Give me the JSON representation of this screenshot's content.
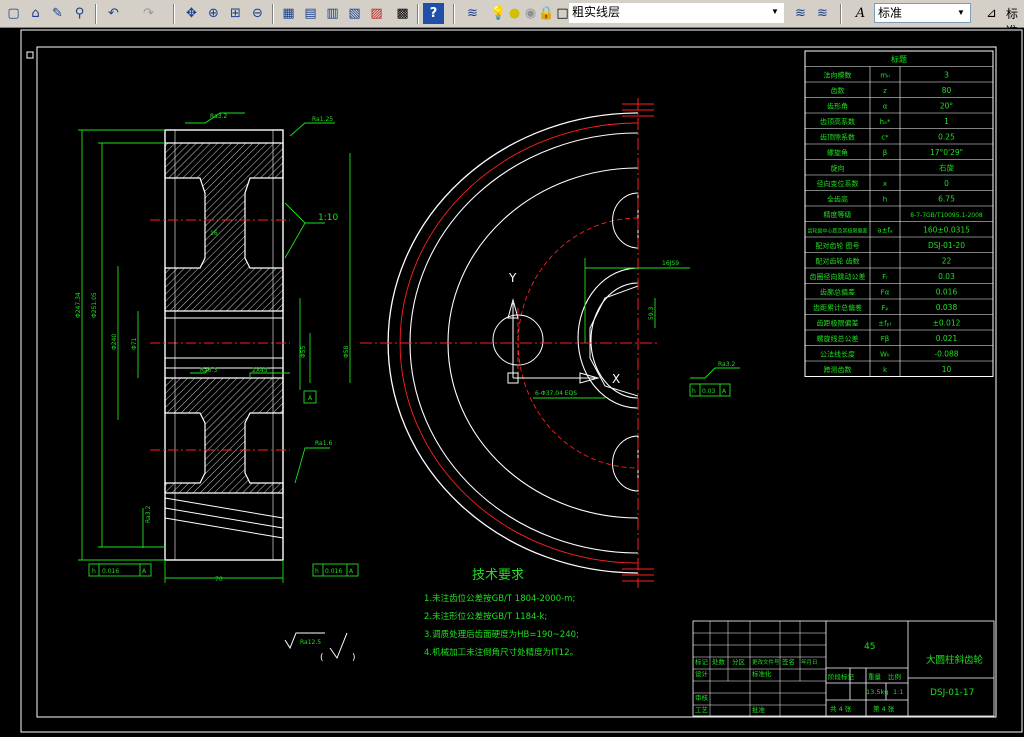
{
  "toolbar": {
    "layer_name": "粗实线层",
    "text_style": "标准",
    "text_style_2": "标准",
    "icons": [
      "new-icon",
      "open-icon",
      "pencil-icon",
      "match-prop-icon",
      "undo-icon",
      "redo-icon",
      "pan-icon",
      "zoom-realtime-icon",
      "zoom-window-icon",
      "zoom-previous-icon",
      "properties-icon",
      "design-center-icon",
      "tool-palette-icon",
      "sheet-set-icon",
      "markup-icon",
      "calculator-icon",
      "help-icon",
      "layer-manager-icon",
      "layer-state-icon",
      "text-style-icon",
      "dim-style-icon"
    ]
  },
  "drawing": {
    "colors": {
      "green": "#1ee01e",
      "white": "#ffffff",
      "red": "#ff2020",
      "yellow": "#e0e000",
      "cyan": "#30e0e0"
    },
    "tech_req": {
      "title": "技术要求",
      "lines": [
        "1.未注齿位公差按GB/T 1804-2000-m;",
        "2.未注形位公差按GB/T 1184-k;",
        "3.调质处理后齿面硬度为HB=190~240;",
        "4.机械加工未注倒角尺寸处精度为IT12。"
      ]
    },
    "param_table": {
      "header": "标题",
      "rows": [
        [
          "法向模数",
          "mₙ",
          "3"
        ],
        [
          "齿数",
          "z",
          "80"
        ],
        [
          "齿形角",
          "α",
          "20°"
        ],
        [
          "齿顶高系数",
          "hₐ*",
          "1"
        ],
        [
          "齿顶隙系数",
          "c*",
          "0.25"
        ],
        [
          "螺旋角",
          "β",
          "17°0'29\""
        ],
        [
          "旋向",
          "",
          "右旋"
        ],
        [
          "径向变位系数",
          "x",
          "0"
        ],
        [
          "全齿高",
          "h",
          "6.75"
        ],
        [
          "精度等级",
          "",
          "8-7-7GB/T10095.1-2008"
        ],
        [
          "齿轮副中心距及其极限偏差",
          "a±fₐ",
          "160±0.0315"
        ],
        [
          "配对齿轮 图号",
          "",
          "DSJ-01-20"
        ],
        [
          "配对齿轮 齿数",
          "",
          "22"
        ],
        [
          "齿圈径向跳动公差",
          "Fᵣ",
          "0.03"
        ],
        [
          "齿廓总偏差",
          "Fα",
          "0.016"
        ],
        [
          "齿距累计总偏差",
          "Fₚ",
          "0.038"
        ],
        [
          "齿距极限偏差",
          "±fₚₜ",
          "±0.012"
        ],
        [
          "螺旋线总公差",
          "Fβ",
          "0.021"
        ],
        [
          "公法线长度",
          "Wₖ",
          "-0.088"
        ],
        [
          "跨测齿数",
          "k",
          "10"
        ]
      ]
    },
    "title_block": {
      "material": "45",
      "part_name": "大圆柱斜齿轮",
      "drawing_no": "DSJ-01-17",
      "scale": "1:1",
      "mass": "13.5kg",
      "sheet_total": "共 4 张",
      "sheet_no": "第 4 张",
      "labels": [
        "标记",
        "处数",
        "分区",
        "更改文件号",
        "签名",
        "年月日",
        "设计",
        "标准化",
        "审核",
        "工艺",
        "批准",
        "阶段标记",
        "重量",
        "比例"
      ]
    },
    "dims": {
      "width": "70",
      "left_vertical_1": "Φ247.34",
      "left_vertical_2": "Φ251.05",
      "left_vertical_3": "Φ240",
      "center_dim": "Φ55",
      "right_vertical": "Φ58",
      "taper": "1:10",
      "chamfer": "2X45°",
      "keyway_width": "16",
      "keyway_depth": "59.3",
      "hub_dim": "Φ71",
      "tolerance_1": "0.016",
      "tolerance_2": "0.016",
      "tolerance_3": "0.03",
      "roughness_1": "Ra3.2",
      "roughness_2": "Ra1.25",
      "roughness_3": "Ra6.3",
      "roughness_4": "Ra1.6",
      "roughness_5": "Ra3.2",
      "roughness_6": "Ra12.5",
      "datum": "A",
      "hole_note": "6-Φ37.04 EQS",
      "keyway_tol": "16JS9"
    }
  }
}
